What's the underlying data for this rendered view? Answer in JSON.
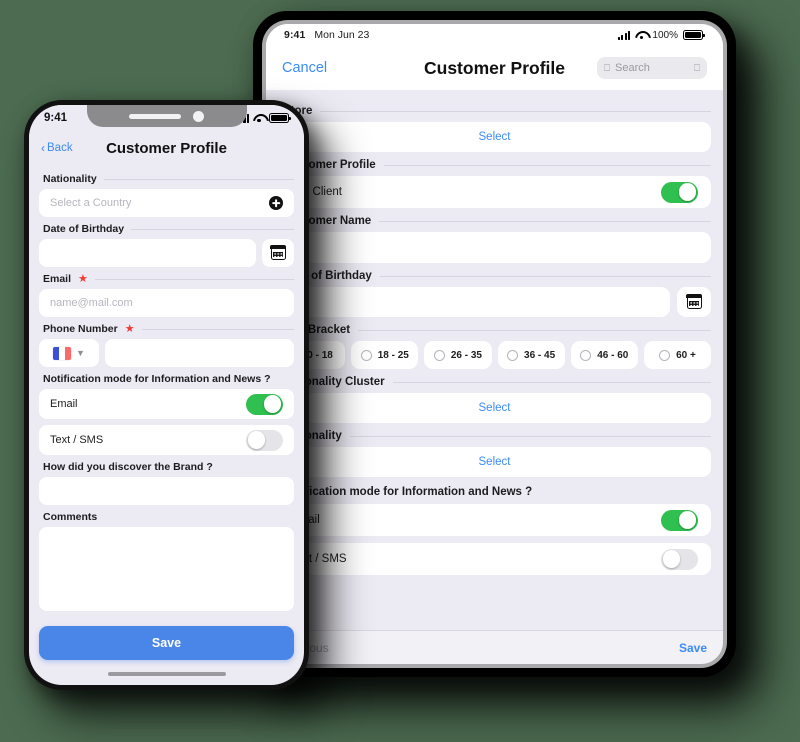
{
  "tablet": {
    "status_bar": {
      "time": "9:41",
      "date": "Mon Jun 23",
      "battery_percent": "100%"
    },
    "nav": {
      "cancel_label": "Cancel",
      "title": "Customer Profile",
      "search_placeholder": "Search",
      "search_icon": "magnifier-icon",
      "mic_icon": "microphone-icon"
    },
    "sections": {
      "store": {
        "label": "Store",
        "select_label": "Select"
      },
      "customer_profile": {
        "label": "Customer Profile",
        "vip_label": "VIP Client",
        "vip_state": "on"
      },
      "customer_name": {
        "label": "Customer Name",
        "value": ""
      },
      "date_of_birthday": {
        "label": "Date of Birthday",
        "value": "",
        "calendar_icon": "calendar-icon"
      },
      "age_bracket": {
        "label": "Age Bracket",
        "options": [
          "0 - 18",
          "18 - 25",
          "26 - 35",
          "36 - 45",
          "46 - 60",
          "60 +"
        ],
        "selected": ""
      },
      "nationality_cluster": {
        "label": "Nationality Cluster",
        "select_label": "Select"
      },
      "nationality": {
        "label": "Nationality",
        "select_label": "Select"
      },
      "notification": {
        "label": "Notification mode for Information and News ?",
        "email_label": "Email",
        "email_state": "on",
        "sms_label": "Text / SMS",
        "sms_state": "off"
      }
    },
    "footer": {
      "previous_label": "Previous",
      "save_label": "Save"
    }
  },
  "phone": {
    "status_bar": {
      "time": "9:41"
    },
    "nav": {
      "back_label": "Back",
      "back_chevron": "‹",
      "title": "Customer Profile"
    },
    "sections": {
      "nationality": {
        "label": "Nationality",
        "placeholder": "Select a Country",
        "add_icon": "add-circle-icon"
      },
      "date_of_birthday": {
        "label": "Date of Birthday",
        "value": "",
        "calendar_icon": "calendar-icon"
      },
      "email": {
        "label": "Email",
        "required": "★",
        "placeholder": "name@mail.com"
      },
      "phone_number": {
        "label": "Phone Number",
        "required": "★",
        "country_flag": "flag-france-icon",
        "chevron_icon": "chevron-down-icon",
        "value": ""
      },
      "notification": {
        "label": "Notification mode for Information and News ?",
        "email_label": "Email",
        "email_state": "on",
        "sms_label": "Text / SMS",
        "sms_state": "off"
      },
      "discover": {
        "label": "How did you discover the Brand ?",
        "value": ""
      },
      "comments": {
        "label": "Comments",
        "value": ""
      }
    },
    "save_label": "Save"
  },
  "colors": {
    "accent_blue": "#3b8cf7",
    "button_blue": "#4a86e8",
    "toggle_green": "#2fc04f",
    "required_red": "#ef3b32",
    "background": "#4c6b50"
  }
}
